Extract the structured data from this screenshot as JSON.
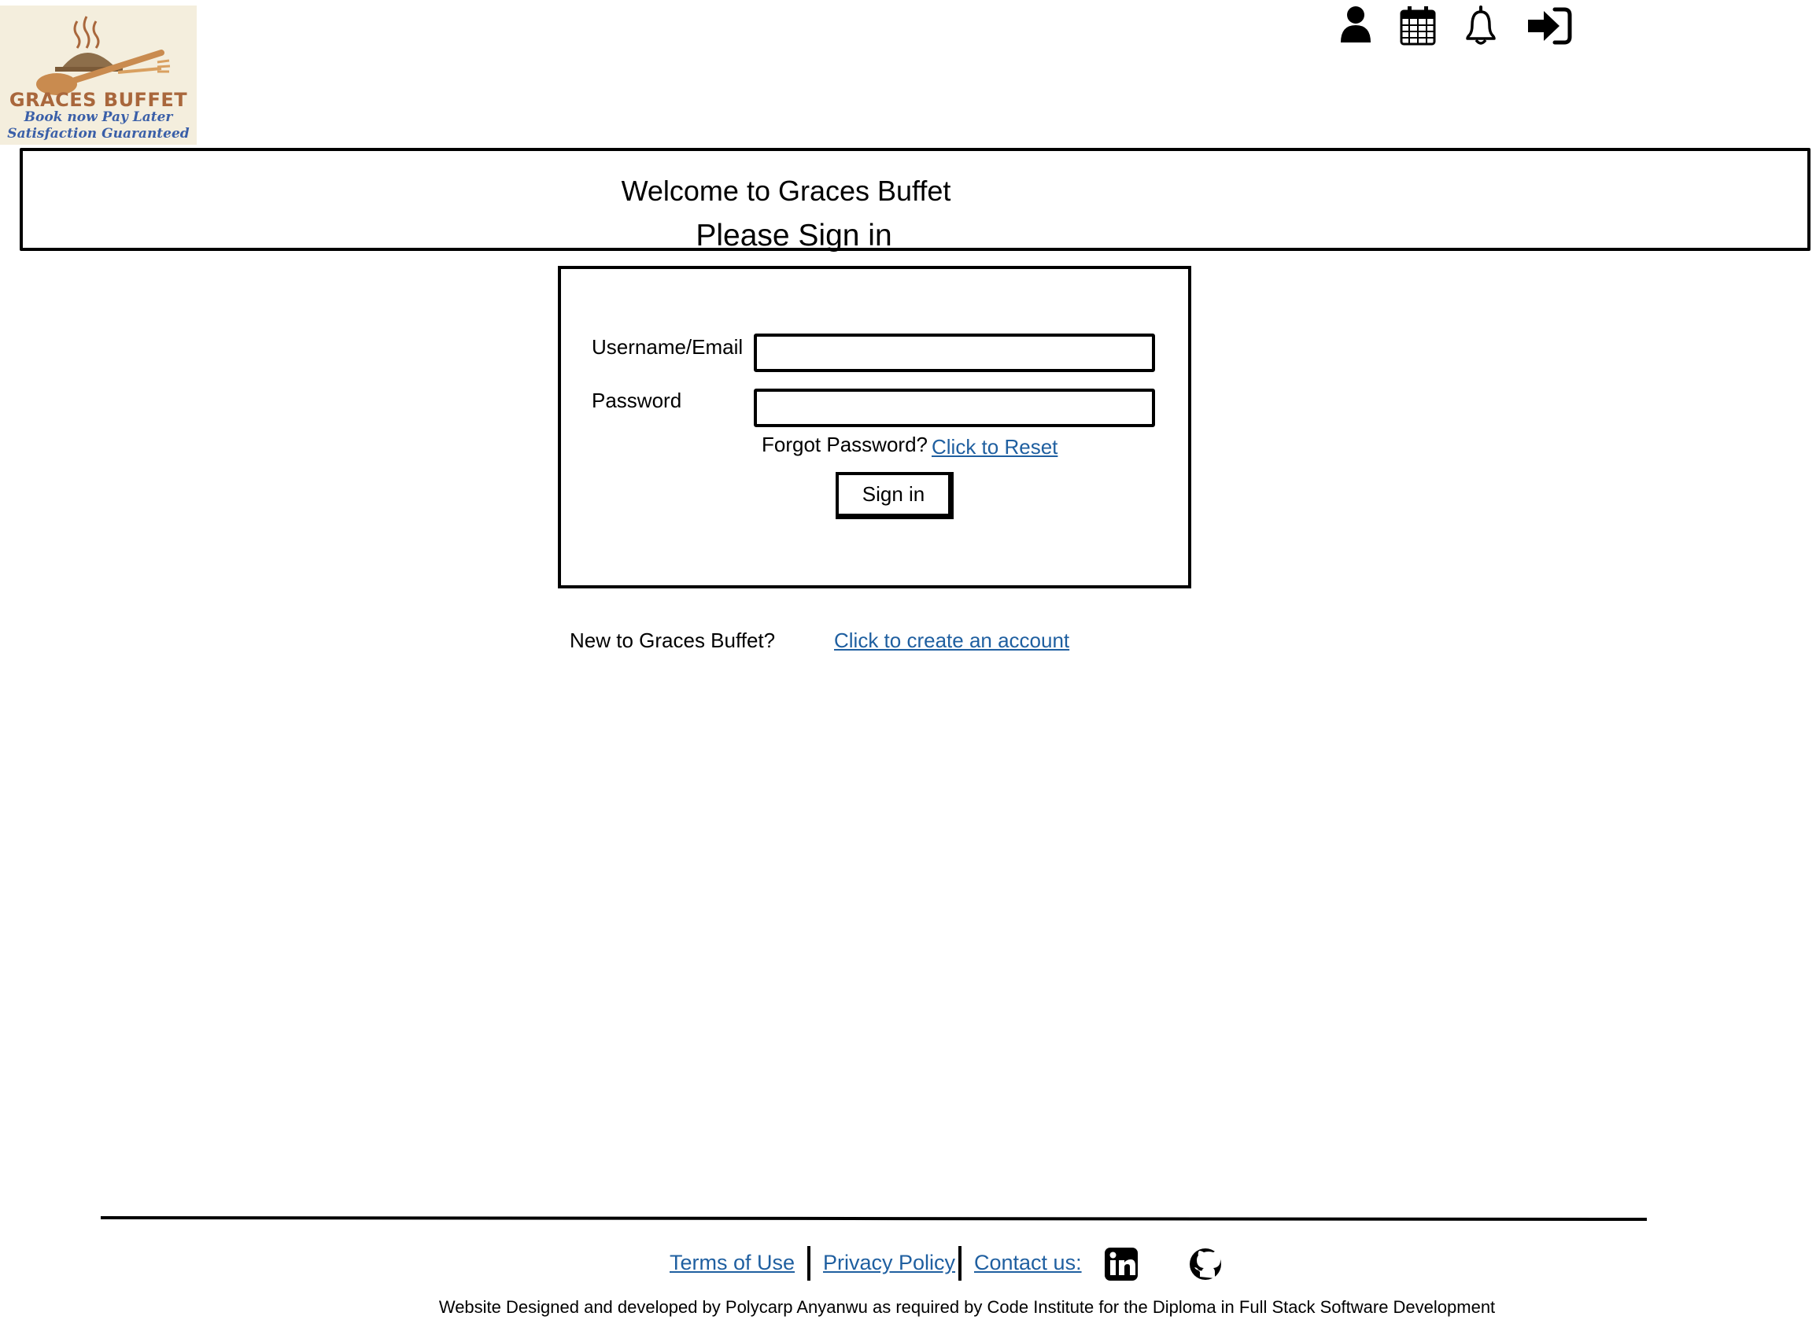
{
  "logo": {
    "title": "GRACES BUFFET",
    "tagline_1": "Book now Pay Later",
    "tagline_2": "Satisfaction Guaranteed"
  },
  "header": {
    "icons": [
      "user-icon",
      "calendar-icon",
      "bell-icon",
      "sign-in-icon"
    ]
  },
  "banner": {
    "welcome": "Welcome to Graces Buffet",
    "prompt": "Please Sign in"
  },
  "signin_form": {
    "username_label": "Username/Email",
    "username_value": "",
    "password_label": "Password",
    "password_value": "",
    "forgot_text": "Forgot Password?",
    "reset_link": "Click to Reset",
    "submit_label": "Sign in"
  },
  "register": {
    "text": "New to Graces Buffet?",
    "link": "Click to create an account"
  },
  "footer": {
    "terms": "Terms of Use",
    "privacy": "Privacy Policy",
    "contact": "Contact us:",
    "social_icons": [
      "linkedin-icon",
      "github-icon"
    ],
    "credit": "Website Designed and developed by Polycarp Anyanwu as required by Code Institute for the  Diploma in Full Stack Software Development"
  },
  "colors": {
    "link": "#1f5fa0",
    "logo_brown": "#a9673c",
    "logo_blue": "#3a5fa8",
    "logo_bg": "#f4eedd"
  }
}
